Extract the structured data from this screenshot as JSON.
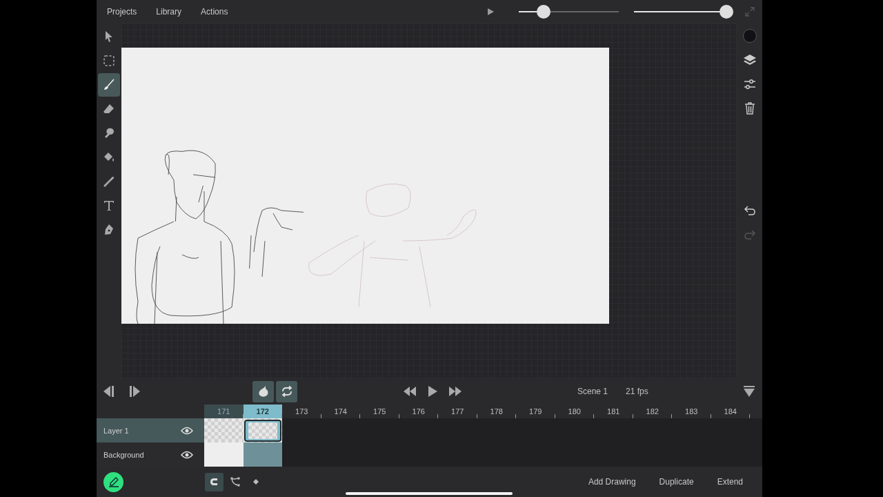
{
  "menu": [
    "Projects",
    "Library",
    "Actions"
  ],
  "playback": {
    "sliders": [
      {
        "level": 0.25
      },
      {
        "level": 1
      }
    ]
  },
  "tools": [
    {
      "kind": "pointer",
      "selected": false
    },
    {
      "kind": "marquee",
      "selected": false
    },
    {
      "kind": "brush",
      "selected": true
    },
    {
      "kind": "eraser",
      "selected": false
    },
    {
      "kind": "smudge",
      "selected": false
    },
    {
      "kind": "fill",
      "selected": false
    },
    {
      "kind": "eyedropper",
      "selected": false
    },
    {
      "kind": "text",
      "selected": false
    },
    {
      "kind": "pen",
      "selected": false
    }
  ],
  "history": {
    "undo": {
      "disabled": false
    },
    "redo": {
      "disabled": true
    }
  },
  "timeline": {
    "onion_skin": {
      "on": true
    },
    "loop": {
      "on": true
    },
    "scene": "Scene 1",
    "fps": "21 fps",
    "frames": [
      {
        "label": "171",
        "selected": false
      },
      {
        "label": "172",
        "selected": true
      },
      {
        "label": "173",
        "selected": false
      },
      {
        "label": "174",
        "selected": false
      },
      {
        "label": "175",
        "selected": false
      },
      {
        "label": "176",
        "selected": false
      },
      {
        "label": "177",
        "selected": false
      },
      {
        "label": "178",
        "selected": false
      },
      {
        "label": "179",
        "selected": false
      },
      {
        "label": "180",
        "selected": false
      },
      {
        "label": "181",
        "selected": false
      },
      {
        "label": "182",
        "selected": false
      },
      {
        "label": "183",
        "selected": false
      },
      {
        "label": "184",
        "selected": false
      }
    ],
    "layers": [
      {
        "name": "Layer 1",
        "selected": true,
        "visible": true,
        "kind": "transparent",
        "cells": [
          {
            "selected": false
          },
          {
            "selected": true
          }
        ]
      },
      {
        "name": "Background",
        "selected": false,
        "visible": true,
        "kind": "solid",
        "cells": [
          {
            "selected": false
          },
          {
            "selected": false
          }
        ]
      }
    ]
  },
  "modes": [
    {
      "kind": "snap",
      "selected": true
    },
    {
      "kind": "path",
      "selected": false
    },
    {
      "kind": "keyframe",
      "selected": false
    }
  ],
  "actions": [
    "Add Drawing",
    "Duplicate",
    "Extend"
  ]
}
